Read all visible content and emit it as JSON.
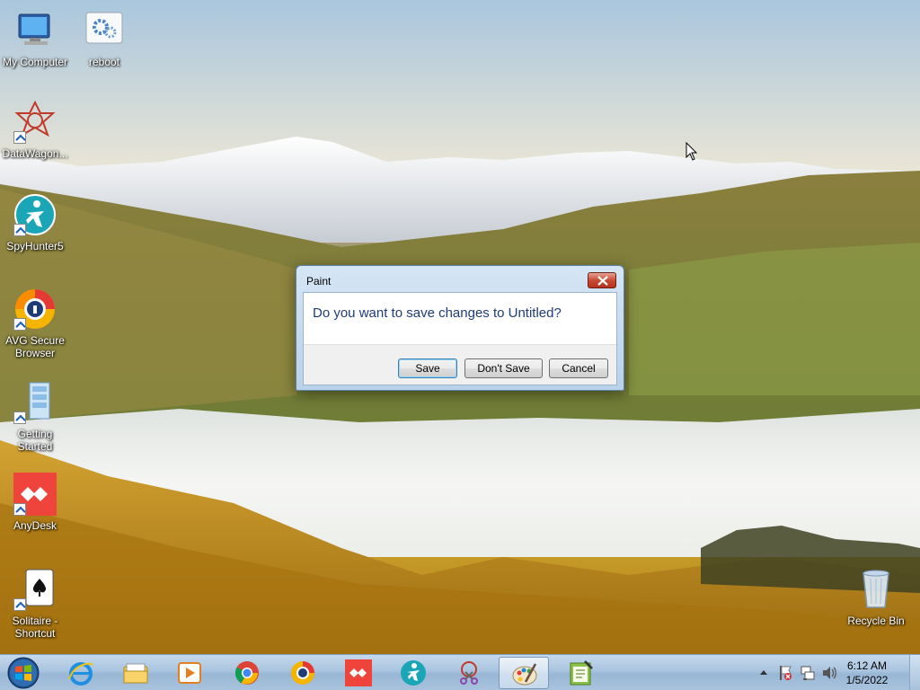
{
  "desktop": {
    "icons": [
      {
        "label": "My Computer",
        "icon": "computer-icon"
      },
      {
        "label": "reboot",
        "icon": "gear-icon"
      },
      {
        "label": "DataWagon...",
        "icon": "datawagon-icon"
      },
      {
        "label": "SpyHunter5",
        "icon": "spyhunter-icon"
      },
      {
        "label": "AVG Secure Browser",
        "icon": "avg-browser-icon"
      },
      {
        "label": "Getting Started",
        "icon": "getting-started-icon"
      },
      {
        "label": "AnyDesk",
        "icon": "anydesk-icon"
      },
      {
        "label": "Solitaire - Shortcut",
        "icon": "solitaire-icon"
      },
      {
        "label": "Recycle Bin",
        "icon": "recycle-bin-icon"
      }
    ]
  },
  "dialog": {
    "title": "Paint",
    "message": "Do you want to save changes to Untitled?",
    "buttons": {
      "save": "Save",
      "dont_save": "Don't Save",
      "cancel": "Cancel"
    }
  },
  "taskbar": {
    "start": "start-orb-icon",
    "pinned": [
      "internet-explorer-icon",
      "file-explorer-icon",
      "media-player-icon",
      "chrome-icon",
      "avg-browser-icon",
      "anydesk-icon",
      "spyhunter-icon",
      "snipping-tool-icon",
      "paint-icon",
      "notepad-plus-icon"
    ],
    "active": "paint-icon",
    "clock": {
      "time": "6:12 AM",
      "date": "1/5/2022"
    }
  },
  "colors": {
    "dialog_message": "#1e3c78",
    "anydesk_red": "#ef443b",
    "taskbar": "#a9c4df"
  }
}
